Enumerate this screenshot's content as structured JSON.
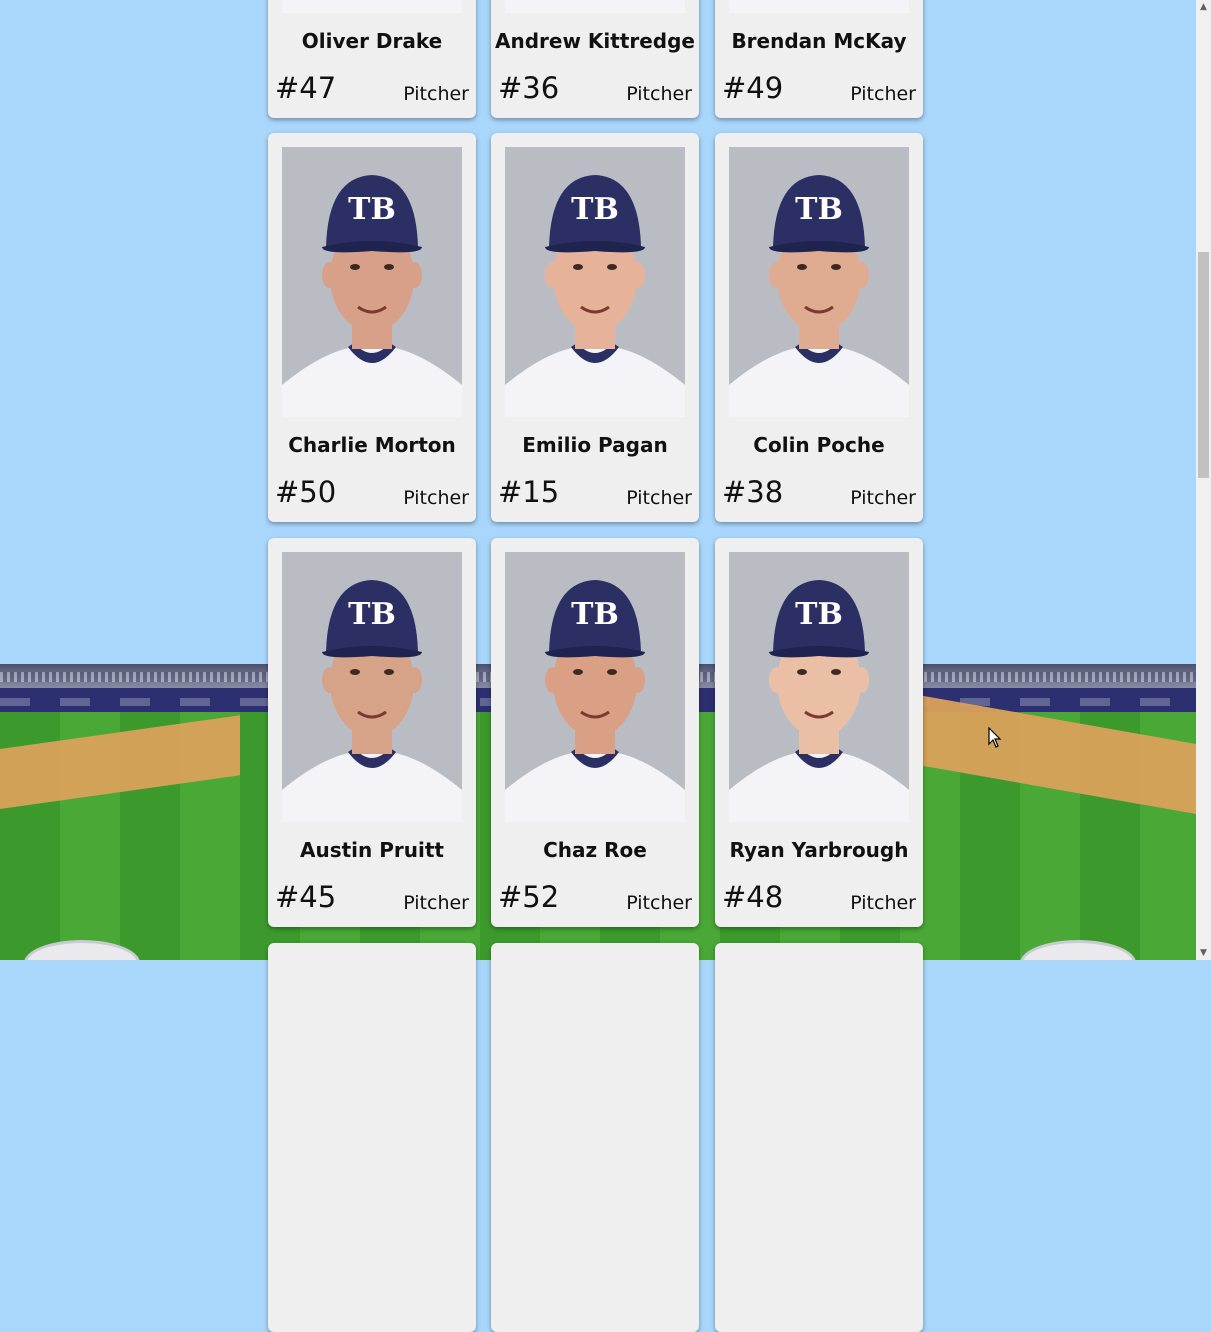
{
  "players": [
    {
      "name": "Oliver Drake",
      "number": "#47",
      "position": "Pitcher"
    },
    {
      "name": "Andrew Kittredge",
      "number": "#36",
      "position": "Pitcher"
    },
    {
      "name": "Brendan McKay",
      "number": "#49",
      "position": "Pitcher"
    },
    {
      "name": "Charlie Morton",
      "number": "#50",
      "position": "Pitcher"
    },
    {
      "name": "Emilio Pagan",
      "number": "#15",
      "position": "Pitcher"
    },
    {
      "name": "Colin Poche",
      "number": "#38",
      "position": "Pitcher"
    },
    {
      "name": "Austin Pruitt",
      "number": "#45",
      "position": "Pitcher"
    },
    {
      "name": "Chaz Roe",
      "number": "#52",
      "position": "Pitcher"
    },
    {
      "name": "Ryan Yarbrough",
      "number": "#48",
      "position": "Pitcher"
    }
  ],
  "cap_logo_text": "TB",
  "colors": {
    "page_background": "#a9d6fb",
    "card_background": "#efefef",
    "cap_navy": "#2b2f63",
    "jersey_white": "#f4f4f8"
  }
}
